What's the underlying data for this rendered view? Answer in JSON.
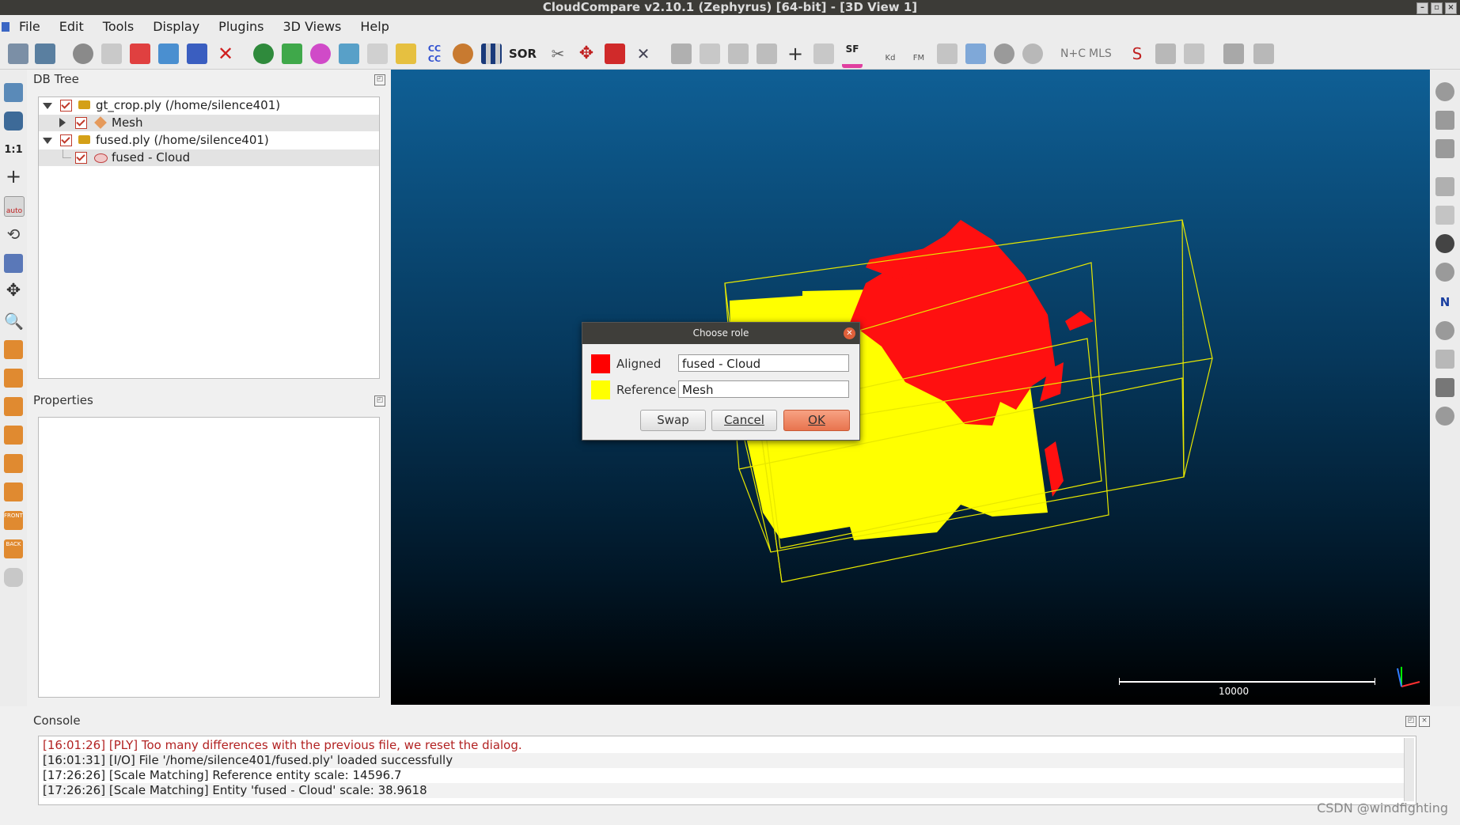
{
  "window": {
    "title": "CloudCompare v2.10.1 (Zephyrus) [64-bit] - [3D View 1]"
  },
  "menu": [
    "File",
    "Edit",
    "Tools",
    "Display",
    "Plugins",
    "3D Views",
    "Help"
  ],
  "toolbar_icons": [
    "open-icon",
    "save-icon",
    "translate-icon",
    "list-icon",
    "point-picking-icon",
    "clone-icon",
    "merge-icon",
    "delete-icon",
    "registration-icon",
    "fine-registration-icon",
    "sample-icon",
    "subsample-icon",
    "normals-icon",
    "cc-icon",
    "sphere-icon",
    "checker-icon",
    "sor-icon",
    "scissors-icon",
    "transform-icon",
    "segment-icon",
    "cross-icon",
    "histogram-icon",
    "chart-icon",
    "minmax-icon",
    "table-icon",
    "plus-icon",
    "sf-icon",
    "kd-icon",
    "fm-icon",
    "calc-icon",
    "mesh-icon",
    "sphere-icon-2",
    "nc-icon",
    "mls-icon",
    "s-icon",
    "cloud-icon",
    "export-icon",
    "create-icon",
    "classify-icon"
  ],
  "toolbar_texts": {
    "sor": "SOR",
    "sf": "SF",
    "nc": "N+C",
    "mls": "MLS",
    "kd": "Kd",
    "fm": "FM"
  },
  "dbtree": {
    "title": "DB Tree",
    "items": [
      {
        "label": "gt_crop.ply (/home/silence401)"
      },
      {
        "label": "Mesh"
      },
      {
        "label": "fused.ply (/home/silence401)"
      },
      {
        "label": "fused - Cloud"
      }
    ]
  },
  "properties": {
    "title": "Properties"
  },
  "console": {
    "title": "Console",
    "lines": [
      "[16:01:26] [PLY] Too many differences with the previous file, we reset the dialog.",
      "[16:01:31] [I/O] File '/home/silence401/fused.ply' loaded successfully",
      "[17:26:26] [Scale Matching] Reference entity scale: 14596.7",
      "[17:26:26] [Scale Matching] Entity 'fused - Cloud' scale: 38.9618"
    ],
    "error_color": "#b22222"
  },
  "dialog": {
    "title": "Choose role",
    "aligned_label": "Aligned",
    "aligned_value": "fused - Cloud",
    "aligned_color": "#ff0000",
    "reference_label": "Reference",
    "reference_value": "Mesh",
    "reference_color": "#ffff00",
    "swap": "Swap",
    "cancel": "Cancel",
    "ok": "OK"
  },
  "view3d": {
    "scale_label": "10000"
  },
  "lefttool_texts": {
    "ratio": "1:1",
    "auto": "auto",
    "front": "FRONT",
    "back": "BACK"
  },
  "watermark": "CSDN @windfighting"
}
